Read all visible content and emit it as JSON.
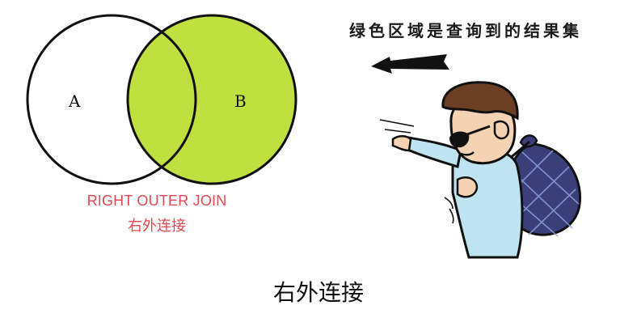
{
  "venn": {
    "set_a_label": "A",
    "set_b_label": "B",
    "highlight_color": "#bfe040",
    "outline_color": "#111111"
  },
  "join": {
    "name_en": "RIGHT OUTER JOIN",
    "name_zh": "右外连接",
    "label_color": "#e8474f"
  },
  "note": {
    "text": "绿色区域是查询到的结果集",
    "arrow_direction": "left"
  },
  "illustration": {
    "icon": "traveler-with-bundle-icon"
  },
  "caption": {
    "text": "右外连接"
  }
}
